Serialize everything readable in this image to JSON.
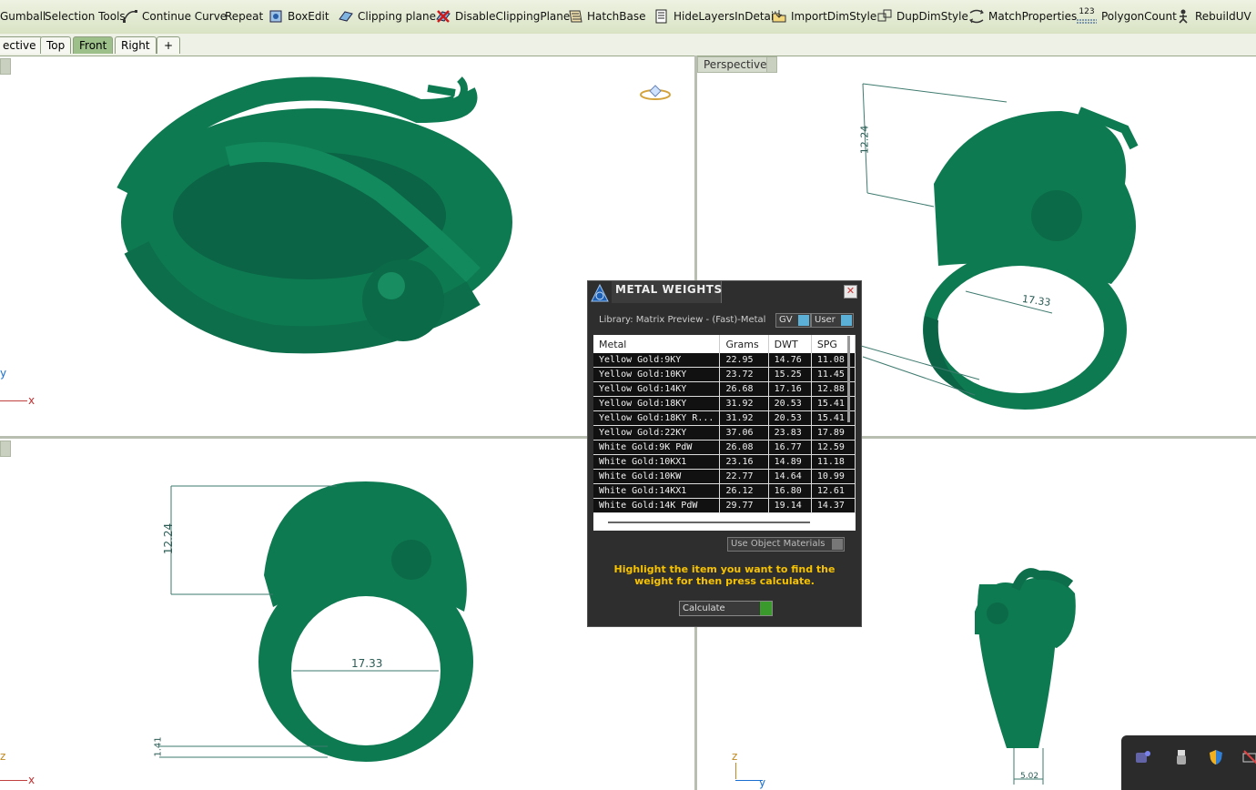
{
  "toolbar": {
    "items": [
      {
        "label": "Gumball",
        "icon": "gumball-icon"
      },
      {
        "label": "Selection Tools",
        "icon": ""
      },
      {
        "label": "Continue Curve",
        "icon": "curve-icon"
      },
      {
        "label": "Repeat",
        "icon": ""
      },
      {
        "label": "BoxEdit",
        "icon": "box-edit-icon"
      },
      {
        "label": "Clipping plane",
        "icon": "clipping-plane-icon"
      },
      {
        "label": "DisableClippingPlane",
        "icon": "disable-clipping-icon"
      },
      {
        "label": "HatchBase",
        "icon": "hatch-icon"
      },
      {
        "label": "HideLayersInDetail",
        "icon": "hide-layers-icon"
      },
      {
        "label": "ImportDimStyle",
        "icon": "import-dim-icon"
      },
      {
        "label": "DupDimStyle",
        "icon": "dup-dim-icon"
      },
      {
        "label": "MatchProperties",
        "icon": "match-properties-icon"
      },
      {
        "label": "PolygonCount",
        "icon": "polygon-count-icon",
        "badge": "123"
      },
      {
        "label": "RebuildUV",
        "icon": "rebuild-uv-icon"
      }
    ]
  },
  "tabs": [
    {
      "label": "ective"
    },
    {
      "label": "Top"
    },
    {
      "label": "Front"
    },
    {
      "label": "Right"
    },
    {
      "label": "+"
    }
  ],
  "viewports": {
    "top_right_label": "Perspective",
    "axis": {
      "y": "y",
      "x": "x",
      "z": "z"
    },
    "dims": {
      "height": "12.24",
      "diameter": "17.33",
      "band": "1.41",
      "width": "5.02"
    }
  },
  "dialog": {
    "title": "METAL WEIGHTS",
    "library": "Library: Matrix Preview - (Fast)-Metal",
    "unit_select": "GV",
    "user_select": "User",
    "columns": [
      "Metal",
      "Grams",
      "DWT",
      "SPG"
    ],
    "rows": [
      [
        "Yellow Gold:9KY",
        "22.95",
        "14.76",
        "11.08"
      ],
      [
        "Yellow Gold:10KY",
        "23.72",
        "15.25",
        "11.45"
      ],
      [
        "Yellow Gold:14KY",
        "26.68",
        "17.16",
        "12.88"
      ],
      [
        "Yellow Gold:18KY",
        "31.92",
        "20.53",
        "15.41"
      ],
      [
        "Yellow Gold:18KY R...",
        "31.92",
        "20.53",
        "15.41"
      ],
      [
        "Yellow Gold:22KY",
        "37.06",
        "23.83",
        "17.89"
      ],
      [
        "White Gold:9K PdW",
        "26.08",
        "16.77",
        "12.59"
      ],
      [
        "White Gold:10KX1",
        "23.16",
        "14.89",
        "11.18"
      ],
      [
        "White Gold:10KW",
        "22.77",
        "14.64",
        "10.99"
      ],
      [
        "White Gold:14KX1",
        "26.12",
        "16.80",
        "12.61"
      ],
      [
        "White Gold:14K PdW",
        "29.77",
        "19.14",
        "14.37"
      ]
    ],
    "materials_select": "Use Object Materials",
    "message": "Highlight the item you want to find the weight for then press calculate.",
    "calculate": "Calculate"
  },
  "colors": {
    "ring": "#0e7a52",
    "ring_dark": "#06563a",
    "accent_msg": "#f7c200",
    "tab_active": "#9dc08b"
  }
}
